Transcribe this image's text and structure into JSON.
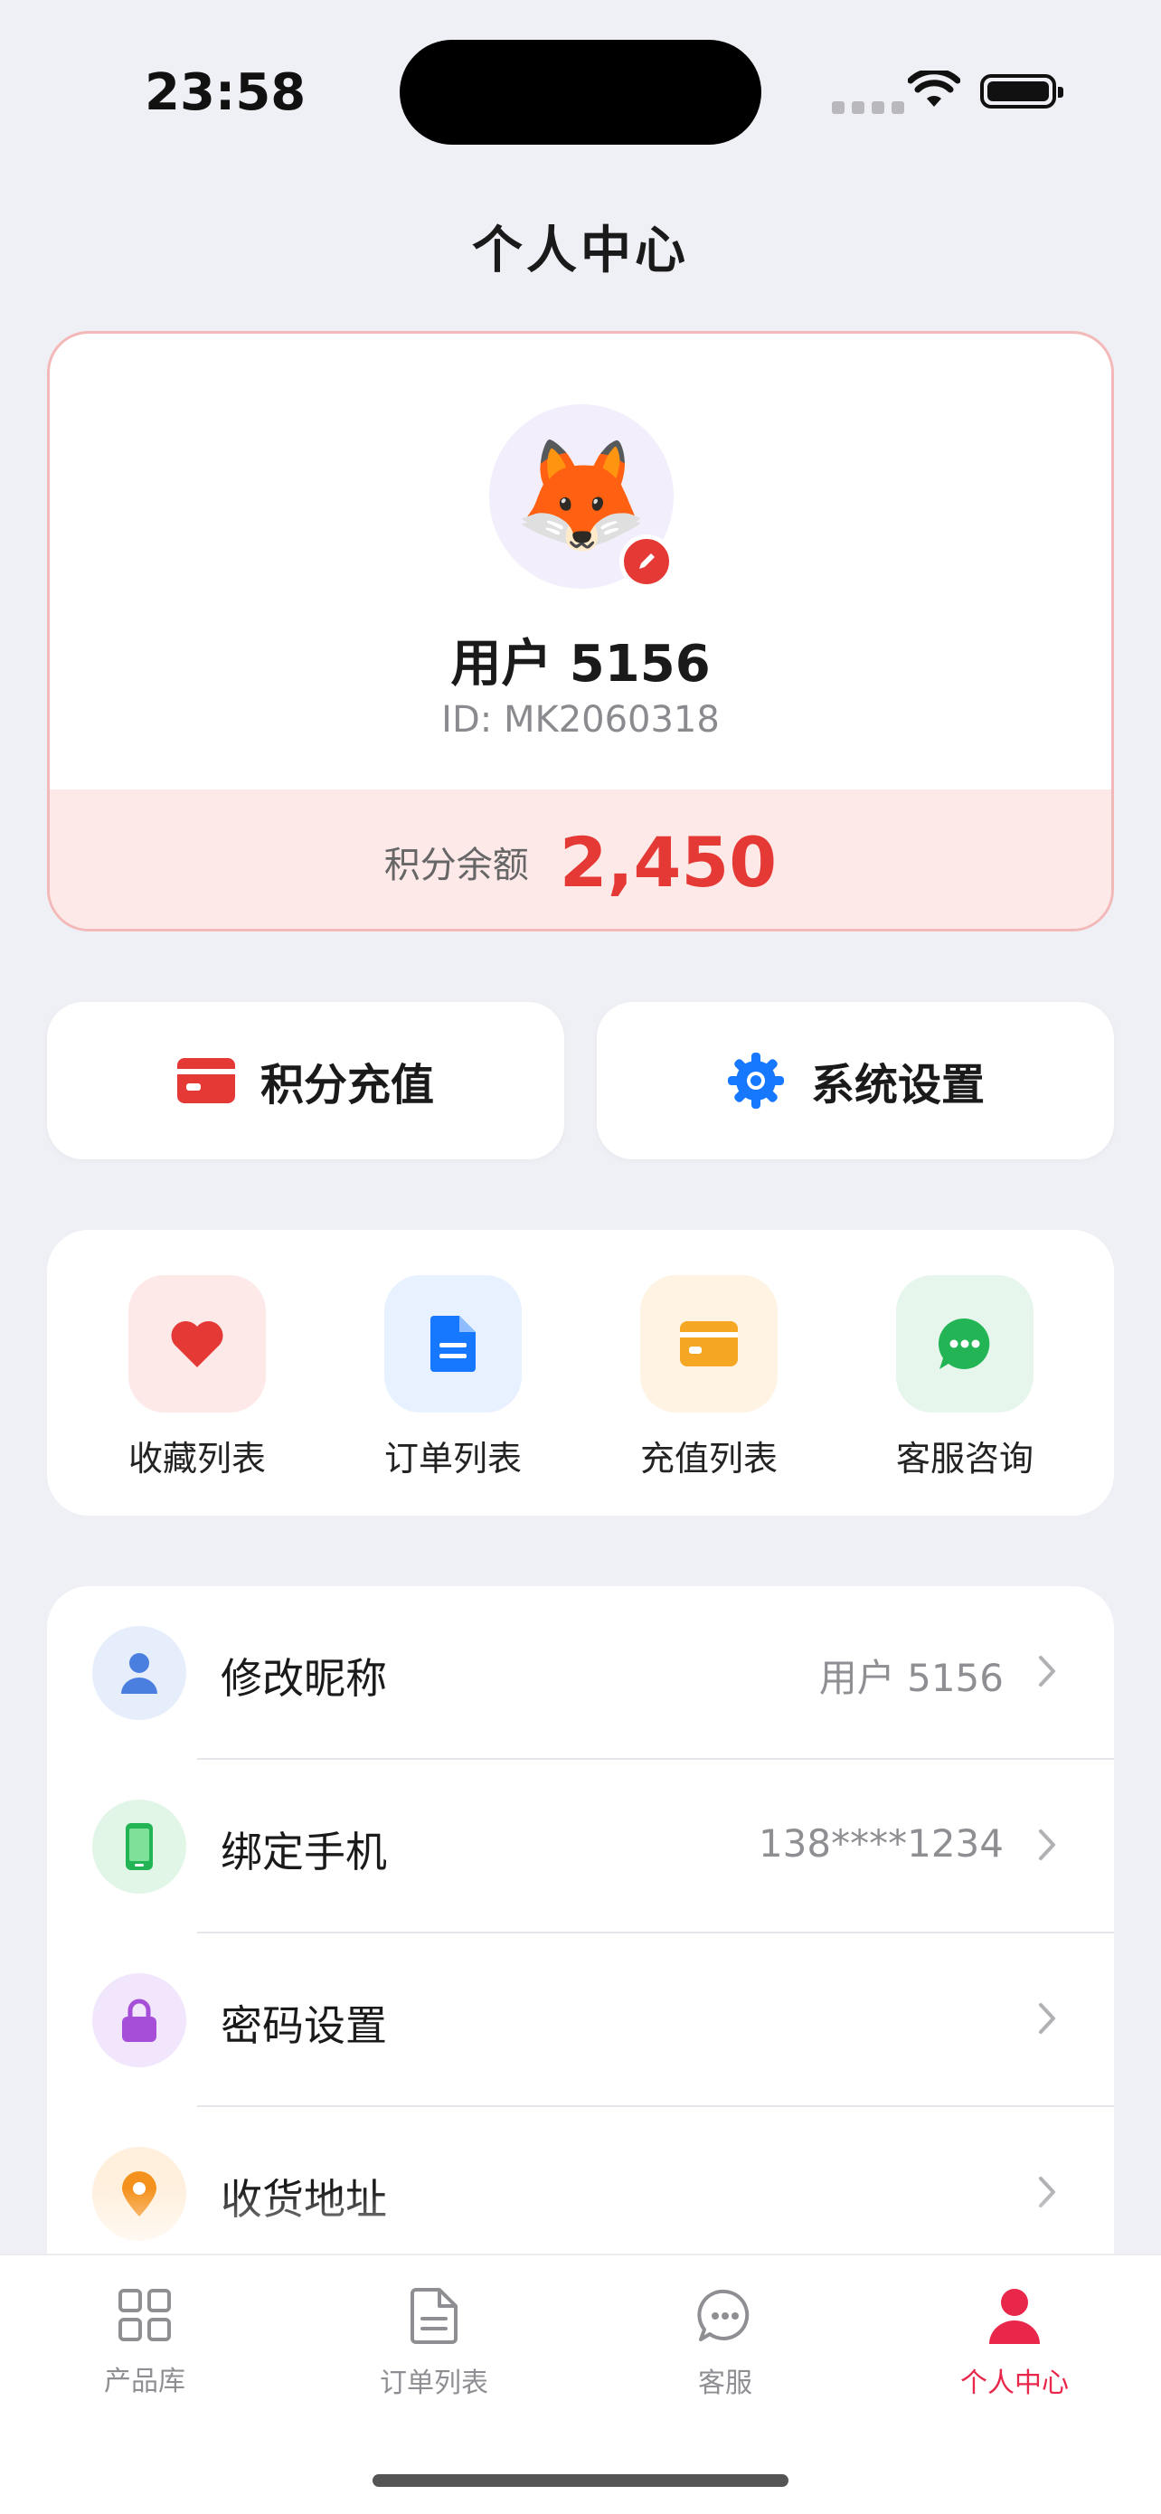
{
  "status": {
    "time": "23:58"
  },
  "page": {
    "title": "个人中心"
  },
  "profile": {
    "avatar_emoji": "🦊",
    "username": "用户 5156",
    "user_id": "ID: MK2060318",
    "points_label": "积分余额",
    "points_value": "2,450"
  },
  "actions": {
    "recharge_label": "积分充值",
    "settings_label": "系统设置"
  },
  "quick": [
    {
      "label": "收藏列表",
      "icon": "heart-icon"
    },
    {
      "label": "订单列表",
      "icon": "document-icon"
    },
    {
      "label": "充值列表",
      "icon": "card-icon"
    },
    {
      "label": "客服咨询",
      "icon": "chat-icon"
    }
  ],
  "list": [
    {
      "label": "修改昵称",
      "value": "用户 5156",
      "icon": "user-icon"
    },
    {
      "label": "绑定手机",
      "value": "138****1234",
      "icon": "phone-icon"
    },
    {
      "label": "密码设置",
      "value": "",
      "icon": "lock-icon"
    },
    {
      "label": "收货地址",
      "value": "",
      "icon": "location-pin-icon"
    }
  ],
  "tabs": [
    {
      "label": "产品库",
      "icon": "grid-icon",
      "active": false
    },
    {
      "label": "订单列表",
      "icon": "document-icon",
      "active": false
    },
    {
      "label": "客服",
      "icon": "chat-icon",
      "active": false
    },
    {
      "label": "个人中心",
      "icon": "user-icon",
      "active": true
    }
  ],
  "colors": {
    "accent_red": "#e53935",
    "tab_active": "#e8274b",
    "background": "#eff0f5"
  }
}
